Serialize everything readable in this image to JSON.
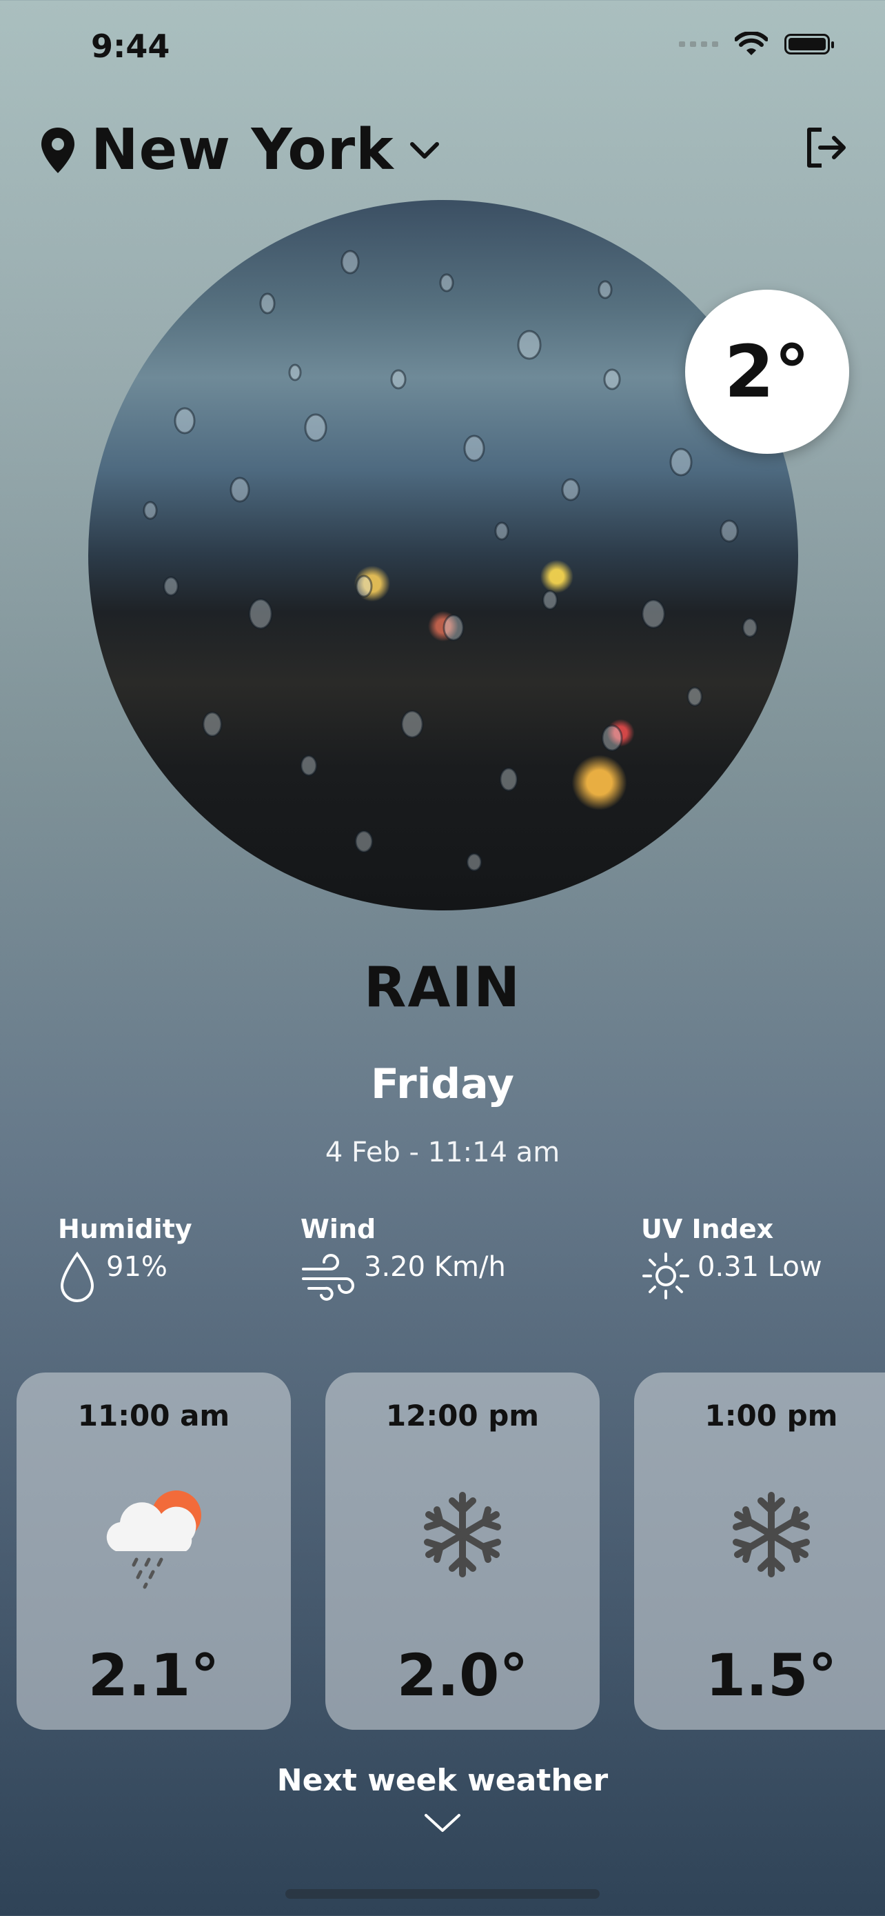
{
  "status_bar": {
    "time": "9:44"
  },
  "header": {
    "city": "New York"
  },
  "current": {
    "temperature": "2°",
    "condition": "RAIN",
    "day": "Friday",
    "date_time": "4 Feb - 11:14 am"
  },
  "stats": {
    "humidity": {
      "label": "Humidity",
      "value": "91%"
    },
    "wind": {
      "label": "Wind",
      "value": "3.20 Km/h"
    },
    "uv": {
      "label": "UV Index",
      "value": "0.31 Low"
    }
  },
  "hourly": [
    {
      "time": "11:00 am",
      "icon": "cloud-sun-rain-icon",
      "temp": "2.1°"
    },
    {
      "time": "12:00 pm",
      "icon": "snowflake-icon",
      "temp": "2.0°"
    },
    {
      "time": "1:00 pm",
      "icon": "snowflake-icon",
      "temp": "1.5°"
    }
  ],
  "footer": {
    "next_week_label": "Next week weather"
  },
  "colors": {
    "sun": "#f26b3a",
    "card_bg": "#c8ced4",
    "text_light": "#ffffff"
  }
}
